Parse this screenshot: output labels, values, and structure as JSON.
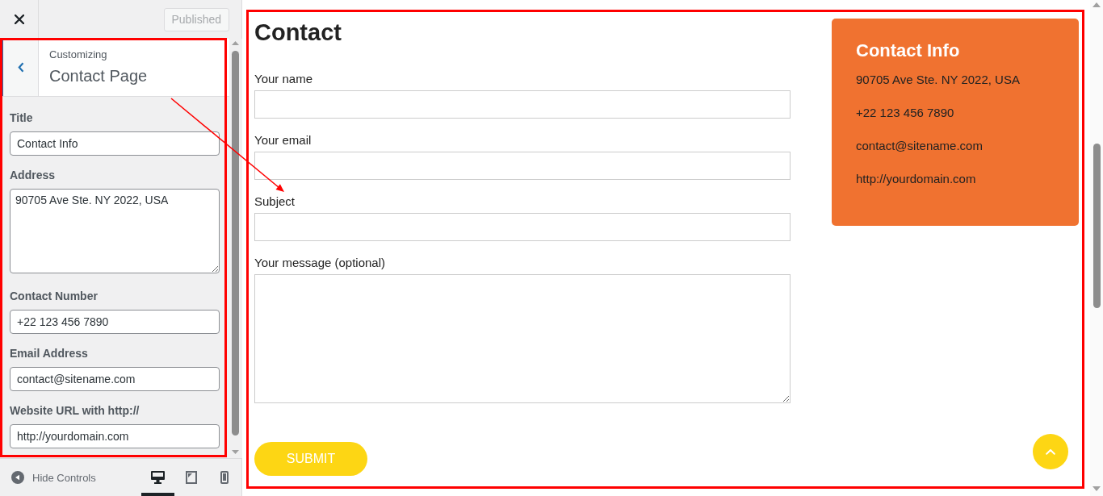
{
  "topbar": {
    "publish_button": {
      "label": "Published",
      "disabled": true
    }
  },
  "section": {
    "eyebrow": "Customizing",
    "title": "Contact Page"
  },
  "controls": [
    {
      "kind": "text",
      "label": "Title",
      "value": "Contact Info"
    },
    {
      "kind": "textarea",
      "label": "Address",
      "value": "90705 Ave Ste. NY 2022, USA"
    },
    {
      "kind": "text",
      "label": "Contact Number",
      "value": "+22 123 456 7890"
    },
    {
      "kind": "text",
      "label": "Email Address",
      "value": "contact@sitename.com"
    },
    {
      "kind": "text",
      "label": "Website URL with http://",
      "value": "http://yourdomain.com"
    }
  ],
  "footer": {
    "toggle_label": "Hide Controls",
    "devices": [
      {
        "kind": "desktop",
        "selected": true
      },
      {
        "kind": "tablet",
        "selected": false
      },
      {
        "kind": "mobile",
        "selected": false
      }
    ]
  },
  "preview": {
    "heading": "Contact",
    "form_fields": [
      {
        "kind": "text",
        "label": "Your name"
      },
      {
        "kind": "text",
        "label": "Your email"
      },
      {
        "kind": "text",
        "label": "Subject"
      },
      {
        "kind": "textarea",
        "label": "Your message (optional)"
      }
    ],
    "submit_label": "SUBMIT",
    "info_card": {
      "title": "Contact Info",
      "lines": [
        "90705 Ave Ste. NY 2022, USA",
        "+22 123 456 7890",
        "contact@sitename.com",
        "http://yourdomain.com"
      ]
    },
    "scroll_top_button": true
  },
  "annotations": {
    "panel_frame": true,
    "preview_frame": true,
    "arrow": true
  }
}
